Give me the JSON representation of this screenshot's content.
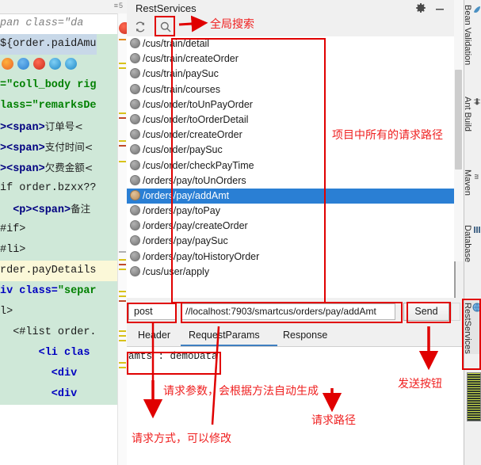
{
  "window": {
    "title": "RestServices",
    "gear_icon": "gear-icon",
    "minimize_icon": "minimize-icon"
  },
  "toolbar": {
    "refresh_icon": "refresh-icon",
    "search_icon": "search-icon"
  },
  "endpoints": [
    {
      "path": "/cus/train/detail",
      "selected": false
    },
    {
      "path": "/cus/train/createOrder",
      "selected": false
    },
    {
      "path": "/cus/train/paySuc",
      "selected": false
    },
    {
      "path": "/cus/train/courses",
      "selected": false
    },
    {
      "path": "/cus/order/toUnPayOrder",
      "selected": false
    },
    {
      "path": "/cus/order/toOrderDetail",
      "selected": false
    },
    {
      "path": "/cus/order/createOrder",
      "selected": false
    },
    {
      "path": "/cus/order/paySuc",
      "selected": false
    },
    {
      "path": "/cus/order/checkPayTime",
      "selected": false
    },
    {
      "path": "/orders/pay/toUnOrders",
      "selected": false
    },
    {
      "path": "/orders/pay/addAmt",
      "selected": true
    },
    {
      "path": "/orders/pay/toPay",
      "selected": false
    },
    {
      "path": "/orders/pay/createOrder",
      "selected": false
    },
    {
      "path": "/orders/pay/paySuc",
      "selected": false
    },
    {
      "path": "/orders/pay/toHistoryOrder",
      "selected": false
    },
    {
      "path": "/cus/user/apply",
      "selected": false
    }
  ],
  "request": {
    "method": "post",
    "url": "//localhost:7903/smartcus/orders/pay/addAmt",
    "send_label": "Send"
  },
  "tabs": [
    {
      "label": "Header",
      "active": false
    },
    {
      "label": "RequestParams",
      "active": true
    },
    {
      "label": "Response",
      "active": false
    }
  ],
  "params": {
    "text": "amts : demoData"
  },
  "vertical_tabs": [
    {
      "label": "Bean Validation",
      "icon": "bean-validation-icon",
      "active": false
    },
    {
      "label": "Ant Build",
      "icon": "ant-build-icon",
      "active": false
    },
    {
      "label": "Maven",
      "icon": "maven-icon",
      "active": false
    },
    {
      "label": "Database",
      "icon": "database-icon",
      "active": false
    },
    {
      "label": "RestServices",
      "icon": "rest-services-icon",
      "active": true
    }
  ],
  "annotations": [
    {
      "id": "global-search",
      "text": "全局搜索"
    },
    {
      "id": "all-request-paths",
      "text": "项目中所有的请求路径"
    },
    {
      "id": "send-button",
      "text": "发送按钮"
    },
    {
      "id": "request-params",
      "text": "请求参数，会根据方法自动生成"
    },
    {
      "id": "request-path",
      "text": "请求路径"
    },
    {
      "id": "request-method",
      "text": "请求方式，可以修改"
    }
  ],
  "annotation_color": "#ef2020",
  "accent_color": "#2a7fd4",
  "editor": {
    "mini_label": "≡5",
    "lines": [
      {
        "segments": [
          {
            "t": "pan class=\"da",
            "c": "k-gray"
          }
        ],
        "bg": "none"
      },
      {
        "segments": [
          {
            "t": "${order.paidAmu",
            "c": "k-plain"
          }
        ],
        "bg": "sel"
      },
      {
        "segments": [
          {
            "t": "",
            "c": "k-plain"
          }
        ],
        "bg": "hl"
      },
      {
        "segments": [
          {
            "t": "=\"coll_body rig",
            "c": "k-str"
          }
        ],
        "bg": "hl"
      },
      {
        "segments": [
          {
            "t": "lass=\"remarksDe",
            "c": "k-str"
          }
        ],
        "bg": "hl"
      },
      {
        "segments": [
          {
            "t": "><span>",
            "c": "k-tag"
          },
          {
            "t": "订单号<",
            "c": "k-cjk"
          }
        ],
        "bg": "hl"
      },
      {
        "segments": [
          {
            "t": "><span>",
            "c": "k-tag"
          },
          {
            "t": "支付时间<",
            "c": "k-cjk"
          }
        ],
        "bg": "hl"
      },
      {
        "segments": [
          {
            "t": "><span>",
            "c": "k-tag"
          },
          {
            "t": "欠费金额<",
            "c": "k-cjk"
          }
        ],
        "bg": "hl"
      },
      {
        "segments": [
          {
            "t": "if order.bzxx??",
            "c": "k-plain"
          }
        ],
        "bg": "hl"
      },
      {
        "segments": [
          {
            "t": "  <p><span>",
            "c": "k-tag"
          },
          {
            "t": "备注",
            "c": "k-cjk"
          }
        ],
        "bg": "hl"
      },
      {
        "segments": [
          {
            "t": "#if>",
            "c": "k-plain"
          }
        ],
        "bg": "hl"
      },
      {
        "segments": [
          {
            "t": "#li>",
            "c": "k-plain"
          }
        ],
        "bg": "hl"
      },
      {
        "segments": [
          {
            "t": "rder.payDetails",
            "c": "k-plain"
          }
        ],
        "bg": "hl2"
      },
      {
        "segments": [
          {
            "t": "iv class=",
            "c": "k-attr"
          },
          {
            "t": "\"separ",
            "c": "k-str"
          }
        ],
        "bg": "hl"
      },
      {
        "segments": [
          {
            "t": "l>",
            "c": "k-plain"
          }
        ],
        "bg": "hl"
      },
      {
        "segments": [
          {
            "t": "  <#list order.",
            "c": "k-plain"
          }
        ],
        "bg": "hl"
      },
      {
        "segments": [
          {
            "t": "      <li clas",
            "c": "k-attr"
          }
        ],
        "bg": "hl"
      },
      {
        "segments": [
          {
            "t": "        <div",
            "c": "k-attr"
          }
        ],
        "bg": "hl"
      },
      {
        "segments": [
          {
            "t": "        <div",
            "c": "k-attr"
          }
        ],
        "bg": "hl"
      }
    ]
  }
}
